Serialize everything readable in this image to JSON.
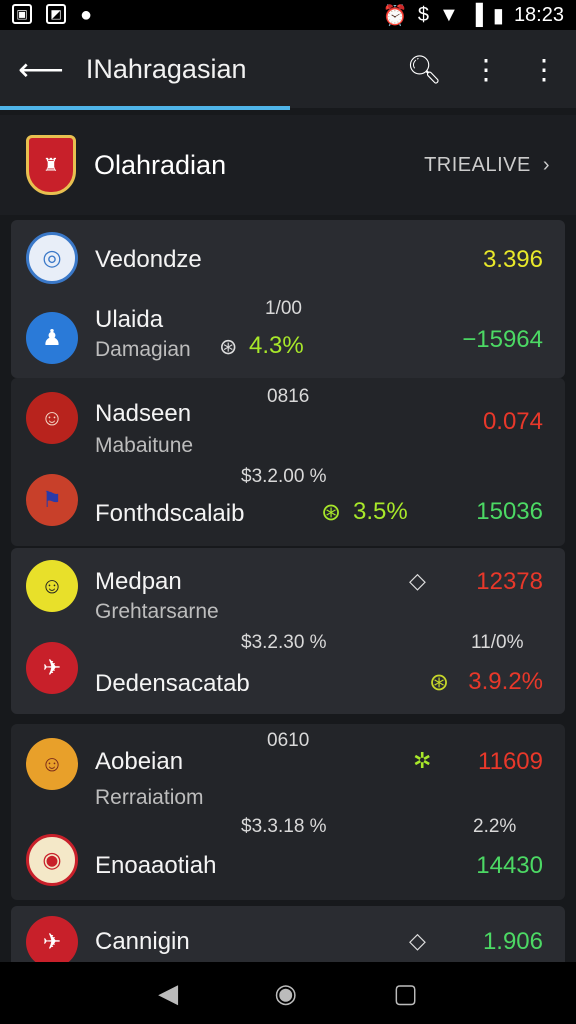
{
  "status_bar": {
    "time": "18:23"
  },
  "app_bar": {
    "title": "INahragasian"
  },
  "league": {
    "name": "Olahradian",
    "tag": "TRIEALIVE"
  },
  "cards": [
    {
      "rows": [
        {
          "name": "Vedondze",
          "value": "3.396"
        },
        {
          "name": "Ulaida",
          "sub": "Damagian",
          "mid": "1/00",
          "pct": "4.3%",
          "value": "−15964"
        }
      ]
    },
    {
      "rows": [
        {
          "name": "Nadseen",
          "sub": "Mabaitune",
          "mid": "0816",
          "value": "0.074"
        },
        {
          "name": "Fonthdscalaib",
          "mid": "$3.2.00 %",
          "pct": "3.5%",
          "value": "15036"
        }
      ]
    },
    {
      "rows": [
        {
          "name": "Medpan",
          "sub": "Grehtarsarne",
          "value": "12378"
        },
        {
          "name": "Dedensacatab",
          "mid": "$3.2.30 %",
          "right_top": "11/0%",
          "pct": "3.9.2%"
        }
      ]
    },
    {
      "rows": [
        {
          "name": "Aobeian",
          "sub": "Rerraiatiom",
          "mid": "0610",
          "value": "11609"
        },
        {
          "name": "Enoaaotiah",
          "mid": "$3.3.18 %",
          "right_top": "2.2%",
          "value": "14430"
        }
      ]
    },
    {
      "rows": [
        {
          "name": "Cannigin",
          "value": "1.906"
        }
      ]
    }
  ]
}
